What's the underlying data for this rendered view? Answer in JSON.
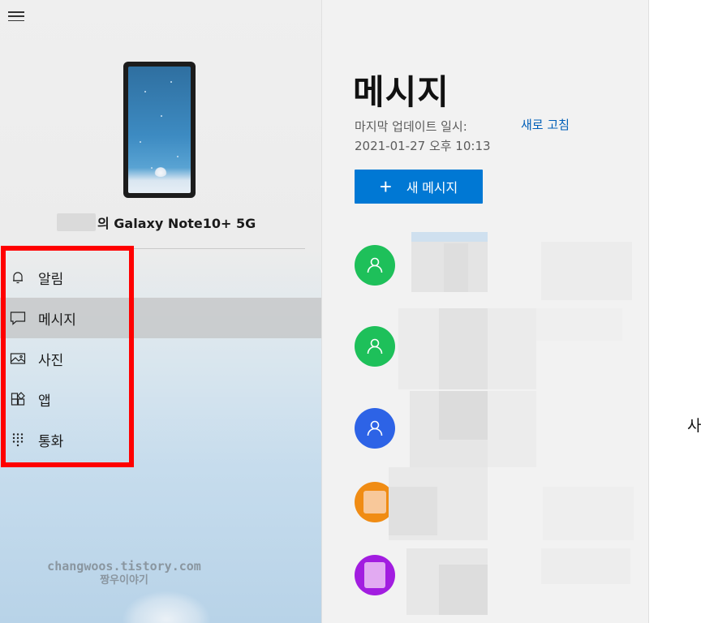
{
  "sidebar": {
    "device_name": "의 Galaxy Note10+ 5G",
    "nav_items": [
      {
        "label": "알림",
        "icon": "bell-icon",
        "selected": false
      },
      {
        "label": "메시지",
        "icon": "message-icon",
        "selected": true
      },
      {
        "label": "사진",
        "icon": "photo-icon",
        "selected": false
      },
      {
        "label": "앱",
        "icon": "apps-icon",
        "selected": false
      },
      {
        "label": "통화",
        "icon": "dialpad-icon",
        "selected": false
      }
    ],
    "watermark_line1": "changwoos.tistory.com",
    "watermark_line2": "짱우이야기"
  },
  "messages": {
    "title": "메시지",
    "last_updated_label": "마지막 업데이트 일시:",
    "last_updated_value": "2021-01-27 오후 10:13",
    "refresh_label": "새로 고침",
    "new_message_label": "새 메시지",
    "avatar_colors": [
      "#1ec05a",
      "#1ec05a",
      "#2d63e6",
      "#f08c14",
      "#a21de0"
    ]
  },
  "right_pane": {
    "partial_text": "사"
  },
  "colors": {
    "accent": "#0078d4",
    "link": "#005fb8",
    "highlight": "#ff0000"
  }
}
